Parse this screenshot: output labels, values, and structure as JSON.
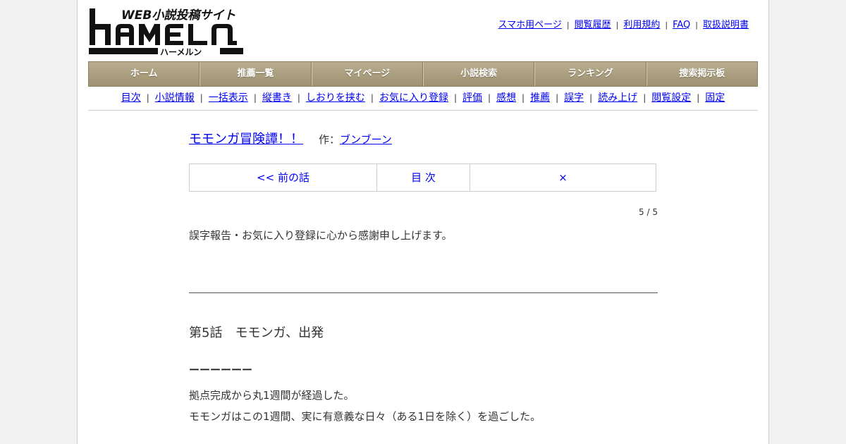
{
  "site": {
    "logo_main": "HAMELN",
    "logo_tagline": "WEB小説投稿サイト",
    "logo_kana": "ハーメルン"
  },
  "top_links": [
    "スマホ用ページ",
    "閲覧履歴",
    "利用規約",
    "FAQ",
    "取扱説明書"
  ],
  "main_nav": [
    "ホーム",
    "推薦一覧",
    "マイページ",
    "小説検索",
    "ランキング",
    "捜索掲示板"
  ],
  "sub_nav": [
    "目次",
    "小説情報",
    "一括表示",
    "縦書き",
    "しおりを挟む",
    "お気に入り登録",
    "評価",
    "感想",
    "推薦",
    "誤字",
    "読み上げ",
    "閲覧設定",
    "固定"
  ],
  "novel": {
    "title": "モモンガ冒険譚！！",
    "author_prefix": "作：",
    "author": "ブンブーン"
  },
  "pager": {
    "prev": "<< 前の話",
    "toc": "目 次",
    "close": "×"
  },
  "page_count": "5 / 5",
  "preface": "誤字報告・お気に入り登録に心から感謝申し上げます。",
  "chapter_title": "第5話　モモンガ、出発",
  "body": {
    "dashes": "ーーーーーー",
    "lines": [
      "拠点完成から丸1週間が経過した。",
      "モモンガはこの1週間、実に有意義な日々（ある1日を除く）を過ごした。"
    ]
  },
  "colors": {
    "link": "#0000ee",
    "nav_bg": "#a89c7c",
    "nav_text": "#ffffff"
  }
}
